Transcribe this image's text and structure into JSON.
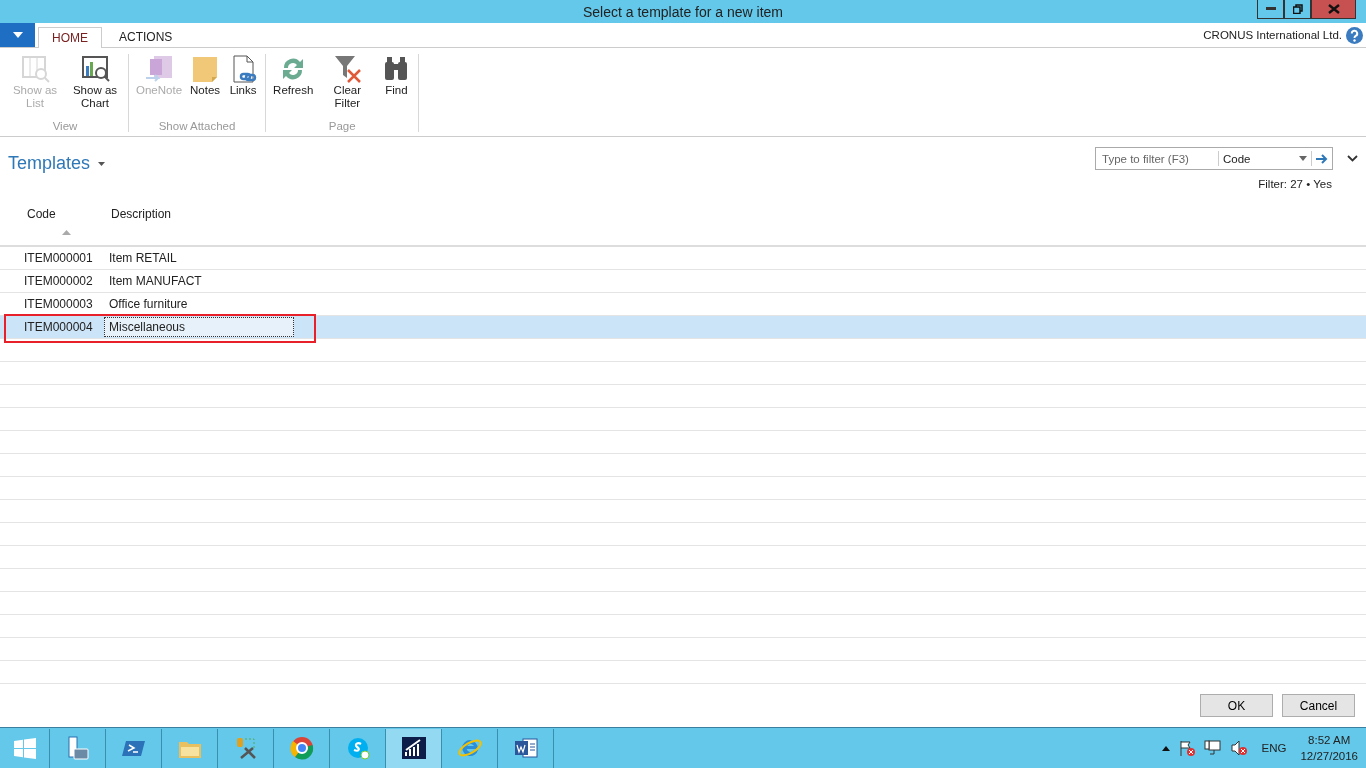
{
  "window": {
    "title": "Select a template for a new item"
  },
  "ribbon_tabs": [
    {
      "label": "HOME",
      "selected": true
    },
    {
      "label": "ACTIONS",
      "selected": false
    }
  ],
  "company": "CRONUS International Ltd.",
  "ribbon_groups": [
    {
      "label": "View",
      "buttons": [
        {
          "label": "Show as List",
          "disabled": true
        },
        {
          "label": "Show as Chart",
          "disabled": false
        }
      ]
    },
    {
      "label": "Show Attached",
      "buttons": [
        {
          "label": "OneNote",
          "disabled": true
        },
        {
          "label": "Notes",
          "disabled": false
        },
        {
          "label": "Links",
          "disabled": false
        }
      ]
    },
    {
      "label": "Page",
      "buttons": [
        {
          "label": "Refresh",
          "disabled": false
        },
        {
          "label": "Clear Filter",
          "disabled": false
        },
        {
          "label": "Find",
          "disabled": false
        }
      ]
    }
  ],
  "page_title": "Templates",
  "filter": {
    "placeholder": "Type to filter (F3)",
    "field": "Code",
    "summary": "Filter: 27 • Yes"
  },
  "table": {
    "columns": [
      "Code",
      "Description"
    ],
    "rows": [
      {
        "cells": [
          "ITEM000001",
          "Item RETAIL"
        ],
        "selected": false
      },
      {
        "cells": [
          "ITEM000002",
          "Item MANUFACT"
        ],
        "selected": false
      },
      {
        "cells": [
          "ITEM000003",
          "Office furniture"
        ],
        "selected": false
      },
      {
        "cells": [
          "ITEM000004",
          "Miscellaneous"
        ],
        "selected": true
      }
    ]
  },
  "buttons": [
    "OK",
    "Cancel"
  ],
  "taskbar": {
    "language": "ENG",
    "time": "8:52 AM",
    "date": "12/27/2016"
  }
}
